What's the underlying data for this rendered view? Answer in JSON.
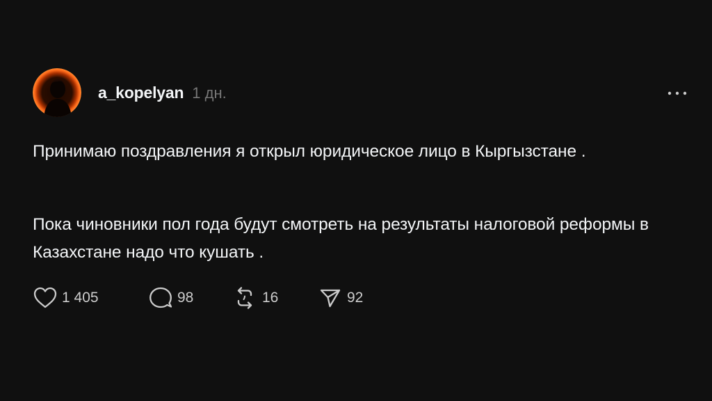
{
  "post": {
    "author": {
      "username": "a_kopelyan",
      "avatar_accent": "#ff5a10"
    },
    "timestamp": "1 дн.",
    "more_icon": "more-horizontal-icon",
    "paragraphs": [
      "Принимаю поздравления я открыл юридическое лицо в Кыргызстане .",
      "Пока чиновники пол года будут смотреть на результаты налоговой реформы в Казахстане надо что кушать ."
    ],
    "actions": {
      "likes": {
        "icon": "heart-icon",
        "count": "1 405"
      },
      "replies": {
        "icon": "comment-icon",
        "count": "98"
      },
      "reposts": {
        "icon": "repost-icon",
        "count": "16"
      },
      "shares": {
        "icon": "send-icon",
        "count": "92"
      }
    }
  },
  "colors": {
    "background": "#101010",
    "text_primary": "#f3f5f7",
    "text_secondary": "#777777",
    "icon": "#cccccc"
  }
}
